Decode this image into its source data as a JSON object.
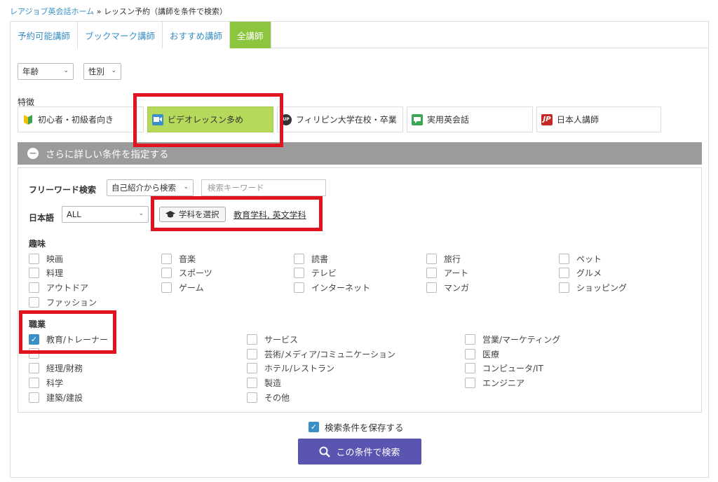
{
  "breadcrumb": {
    "home": "レアジョブ英会話ホーム",
    "separator": " » ",
    "current": "レッスン予約（講師を条件で検索）"
  },
  "tabs": [
    {
      "label": "予約可能講師",
      "active": false
    },
    {
      "label": "ブックマーク講師",
      "active": false
    },
    {
      "label": "おすすめ講師",
      "active": false
    },
    {
      "label": "全講師",
      "active": true
    }
  ],
  "filters": {
    "age": "年齢",
    "gender": "性別"
  },
  "features": {
    "label": "特徴",
    "items": [
      {
        "label": "初心者・初級者向き",
        "icon": "beginner-mark-icon",
        "active": false
      },
      {
        "label": "ビデオレッスン多め",
        "icon": "video-camera-icon",
        "active": true
      },
      {
        "label": "フィリピン大学在校・卒業",
        "icon": "university-badge-icon",
        "active": false
      },
      {
        "label": "実用英会話",
        "icon": "conversation-icon",
        "active": false
      },
      {
        "label": "日本人講師",
        "icon": "jp-flag-icon",
        "icon_text": "JP",
        "active": false
      }
    ]
  },
  "conditions_toggle": {
    "label": "さらに詳しい条件を指定する",
    "icon": "minus-circle-icon"
  },
  "freeword": {
    "label": "フリーワード検索",
    "scope": "自己紹介から検索",
    "placeholder": "検索キーワード"
  },
  "japanese": {
    "label": "日本語",
    "value": "ALL",
    "gakka_button": "学科を選択",
    "gakka_selected": "教育学科, 英文学科"
  },
  "hobbies": {
    "title": "趣味",
    "items": [
      "映画",
      "料理",
      "アウトドア",
      "ファッション",
      "音楽",
      "スポーツ",
      "ゲーム",
      "読書",
      "テレビ",
      "インターネット",
      "旅行",
      "アート",
      "マンガ",
      "ペット",
      "グルメ",
      "ショッピング"
    ]
  },
  "jobs": {
    "title": "職業",
    "items": [
      {
        "label": "教育/トレーナー",
        "checked": true
      },
      {
        "label": "経理/財務",
        "checked": false
      },
      {
        "label": "科学",
        "checked": false
      },
      {
        "label": "建築/建設",
        "checked": false
      },
      {
        "label": "サービス",
        "checked": false
      },
      {
        "label": "芸術/メディア/コミュニケーション",
        "checked": false
      },
      {
        "label": "ホテル/レストラン",
        "checked": false
      },
      {
        "label": "製造",
        "checked": false
      },
      {
        "label": "その他",
        "checked": false
      },
      {
        "label": "営業/マーケティング",
        "checked": false
      },
      {
        "label": "医療",
        "checked": false
      },
      {
        "label": "コンピュータ/IT",
        "checked": false
      },
      {
        "label": "エンジニア",
        "checked": false
      }
    ]
  },
  "save": {
    "label": "検索条件を保存する",
    "checked": true
  },
  "search_button": {
    "label": "この条件で検索",
    "icon": "search-icon"
  },
  "colors": {
    "accent_green": "#8cc63f",
    "link_blue": "#3a8fc6",
    "highlight_red": "#e0141e",
    "search_purple": "#5a55b0",
    "bar_gray": "#9b9b9b"
  }
}
